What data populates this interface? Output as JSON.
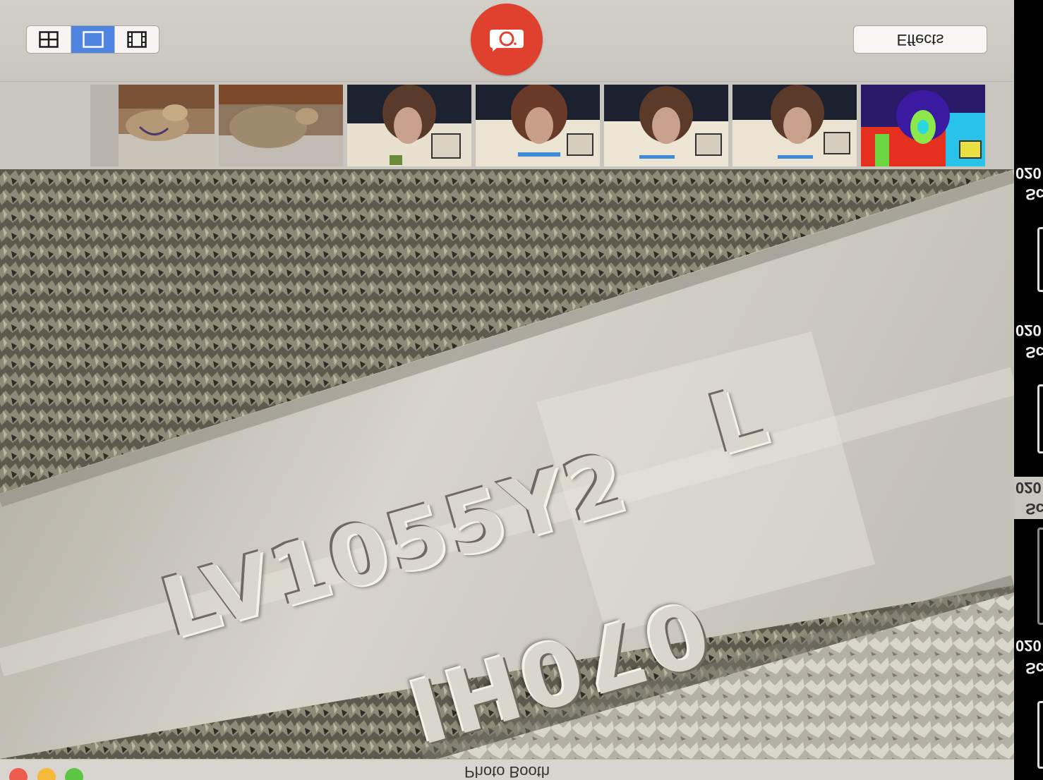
{
  "app": {
    "window_title": "Photo Booth"
  },
  "toolbar": {
    "view_modes": [
      {
        "name": "four-up",
        "icon": "grid-4-icon",
        "active": false
      },
      {
        "name": "single",
        "icon": "single-frame-icon",
        "active": true
      },
      {
        "name": "movie",
        "icon": "film-strip-icon",
        "active": false
      }
    ],
    "shutter_icon": "camera-icon",
    "effects_label": "Effects"
  },
  "thumbnails": [
    {
      "name": "thumb-dog-1",
      "description_icon": "photo-thumbnail"
    },
    {
      "name": "thumb-dog-2",
      "description_icon": "photo-thumbnail"
    },
    {
      "name": "thumb-person-1",
      "description_icon": "photo-thumbnail"
    },
    {
      "name": "thumb-person-2",
      "description_icon": "photo-thumbnail"
    },
    {
      "name": "thumb-person-3",
      "description_icon": "photo-thumbnail"
    },
    {
      "name": "thumb-person-4",
      "description_icon": "photo-thumbnail"
    },
    {
      "name": "thumb-thermal",
      "description_icon": "photo-thumbnail"
    }
  ],
  "viewer": {
    "engraving_line1": "LV1055Y2",
    "engraving_letter": "L",
    "engraving_line2": "070HI"
  },
  "side_window": {
    "fragments": [
      "020",
      "Sc",
      "020",
      "Sc",
      "020",
      "Sc",
      "020",
      "Sc"
    ]
  },
  "colors": {
    "shutter": "#e0412e",
    "active_segment": "#4f84e0",
    "close": "#ee5c50",
    "minimize": "#f5b93a",
    "zoom": "#5ec444"
  }
}
